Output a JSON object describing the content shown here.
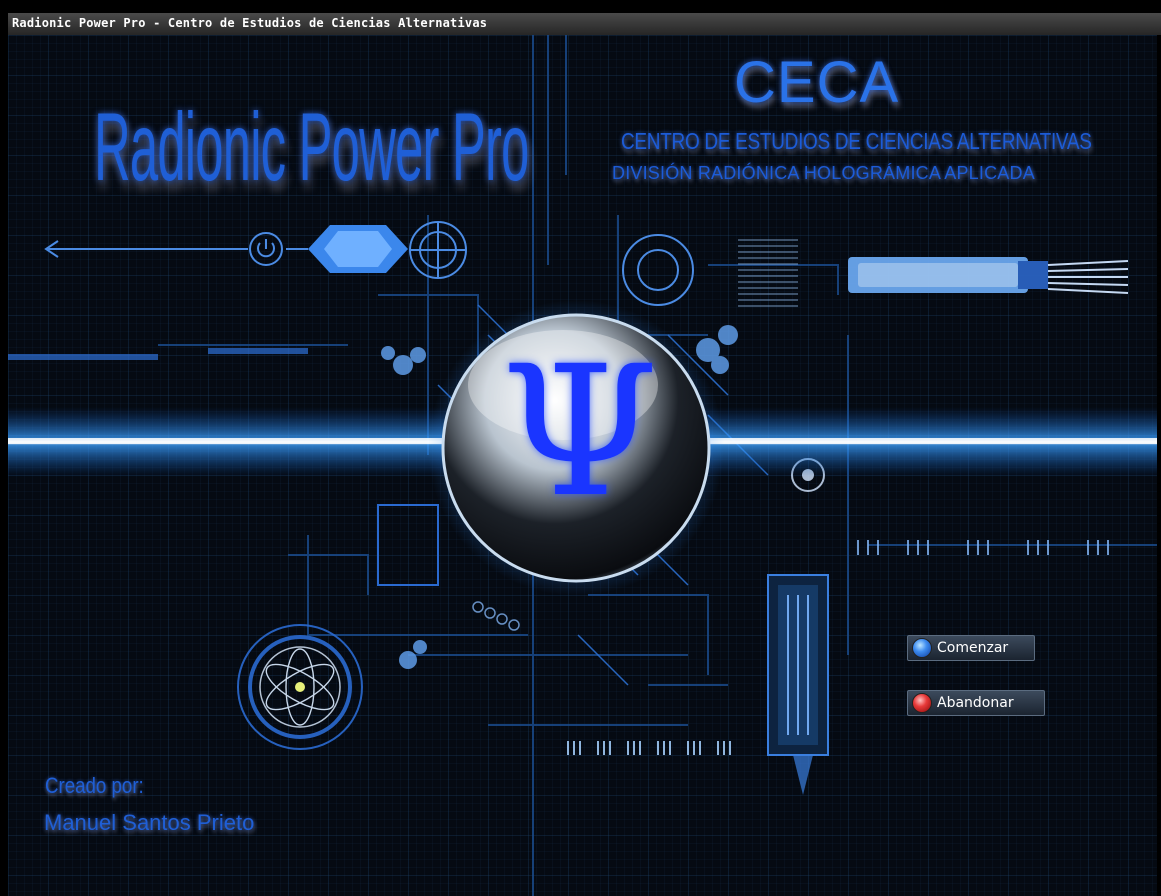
{
  "window": {
    "title": "Radionic Power Pro - Centro de Estudios de Ciencias Alternativas"
  },
  "branding": {
    "app_logo_text": "Radionic Power Pro",
    "org_acronym": "CECA",
    "org_full_name": "CENTRO DE ESTUDIOS DE CIENCIAS ALTERNATIVAS",
    "division": "DIVISIÓN RADIÓNICA HOLOGRÁMICA APLICADA",
    "emblem_symbol": "Ψ"
  },
  "actions": {
    "start_label": "Comenzar",
    "quit_label": "Abandonar"
  },
  "credits": {
    "label": "Creado por:",
    "author": "Manuel Santos Prieto"
  },
  "icons": {
    "start": "blue-orb-icon",
    "quit": "red-orb-icon",
    "emblem": "psi-sphere-icon",
    "atom": "atom-icon"
  },
  "colors": {
    "accent": "#1f5fd6",
    "glow": "#3aa0ff",
    "background": "#050a12"
  }
}
